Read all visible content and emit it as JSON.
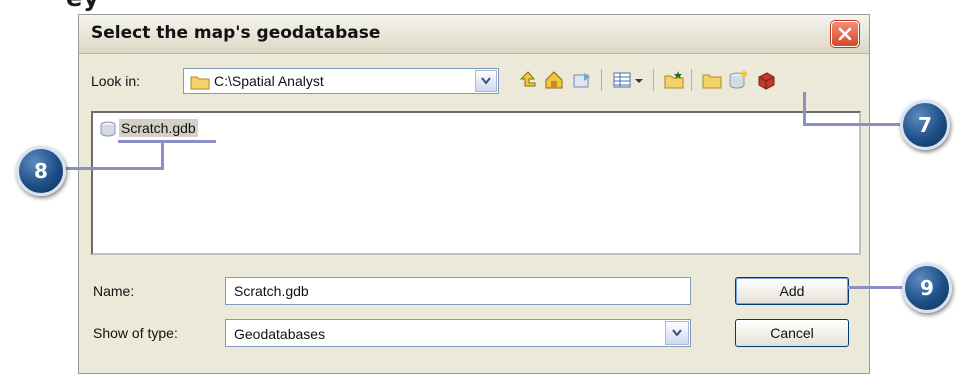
{
  "dialog": {
    "title": "Select the map's geodatabase",
    "look_in_label": "Look in:",
    "look_in_value": "C:\\Spatial Analyst",
    "toolbar_icons": [
      "up-one-level-icon",
      "home-icon",
      "connect-folder-icon",
      "view-list-icon",
      "view-dropdown-icon",
      "new-folder-icon",
      "new-folder-alt-icon",
      "new-geodatabase-icon",
      "delete-icon"
    ],
    "files": [
      {
        "name": "Scratch.gdb",
        "icon": "geodatabase-icon",
        "selected": true
      }
    ],
    "name_label": "Name:",
    "name_value": "Scratch.gdb",
    "type_label": "Show of type:",
    "type_value": "Geodatabases",
    "add_label": "Add",
    "cancel_label": "Cancel"
  },
  "callouts": {
    "seven": "7",
    "eight": "8",
    "nine": "9"
  },
  "colors": {
    "dialog_bg": "#ece9d8",
    "callout": "#1d4f86",
    "callout_line": "#8b8fc8",
    "close_button": "#d6462a"
  }
}
